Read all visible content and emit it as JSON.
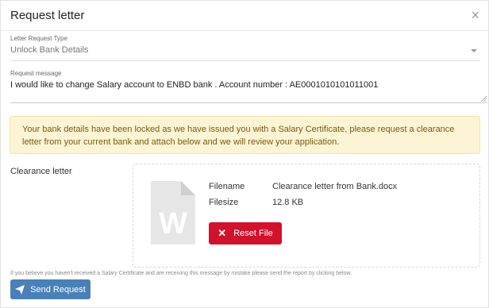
{
  "modal": {
    "title": "Request letter",
    "close_glyph": "×"
  },
  "request_type": {
    "label": "Letter Request Type",
    "value": "Unlock Bank Details"
  },
  "request_message": {
    "label": "Request message",
    "value": "I would like to change Salary account to ENBD bank . Account number : AE0001010101011001"
  },
  "alert": {
    "text": "Your bank details have been locked as we have issued you with a Salary Certificate, please request a clearance letter from your current bank and attach below and we will review your application.",
    "background": "#fcf4d4",
    "text_color": "#7a5b12"
  },
  "clearance": {
    "label": "Clearance letter",
    "file_icon": "word-document-icon",
    "filename_label": "Filename",
    "filename_value": "Clearance letter from Bank.docx",
    "filesize_label": "Filesize",
    "filesize_value": "12.8 KB",
    "reset_label": "Reset File",
    "reset_color": "#d0122d"
  },
  "footer": {
    "note": "If you believe you haven't received a Salary Certificate and are receiving this message by mistake please send the report by clicking below.",
    "send_label": "Send Request",
    "send_icon": "paper-plane-icon",
    "send_color": "#4a80b8"
  }
}
